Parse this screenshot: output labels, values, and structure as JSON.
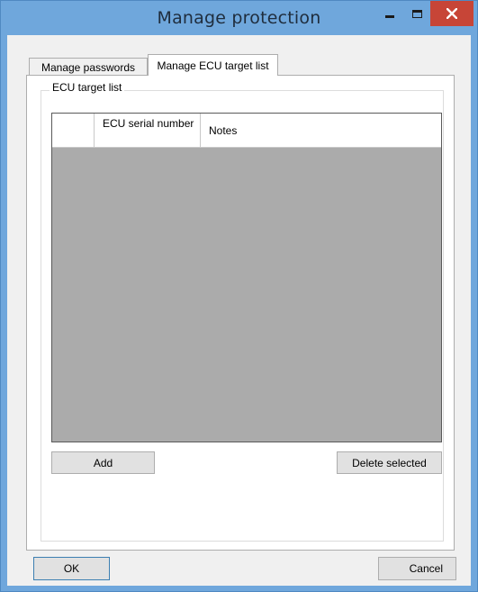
{
  "window": {
    "title": "Manage protection"
  },
  "tabs": [
    {
      "label": "Manage passwords"
    },
    {
      "label": "Manage ECU target list"
    }
  ],
  "active_tab": "Manage ECU target list",
  "group": {
    "label": "ECU target list"
  },
  "grid": {
    "columns": [
      {
        "label": ""
      },
      {
        "label": "ECU serial number"
      },
      {
        "label": "Notes"
      }
    ],
    "rows": []
  },
  "buttons": {
    "add": "Add",
    "delete_selected": "Delete selected",
    "ok": "OK",
    "cancel": "Cancel"
  },
  "colors": {
    "titlebar": "#6fa7dc",
    "close_button": "#c74537",
    "grid_background": "#ababab"
  },
  "icons": {
    "minimize": "minimize-icon",
    "maximize": "maximize-icon",
    "close": "close-icon"
  }
}
